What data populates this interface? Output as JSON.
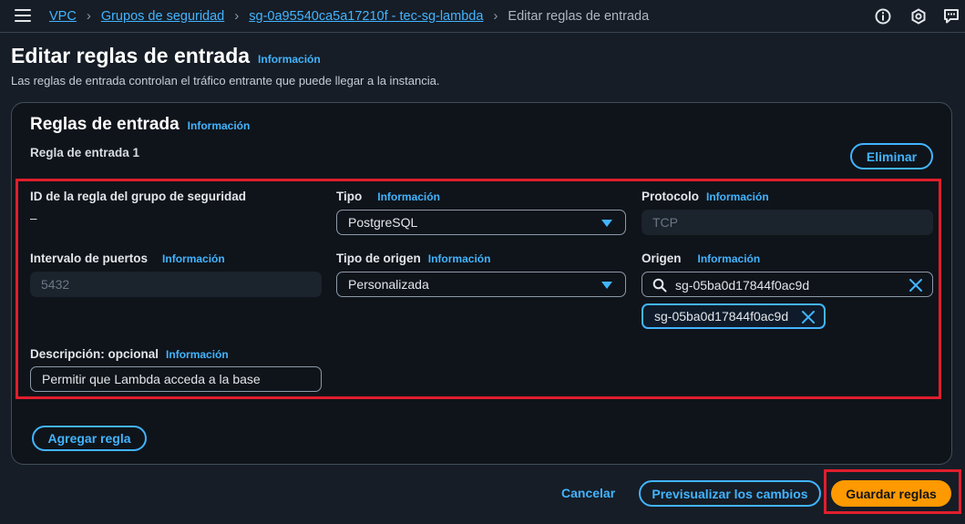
{
  "breadcrumb": {
    "items": [
      "VPC",
      "Grupos de seguridad",
      "sg-0a95540ca5a17210f - tec-sg-lambda"
    ],
    "current": "Editar reglas de entrada"
  },
  "page": {
    "title": "Editar reglas de entrada",
    "info": "Información",
    "description": "Las reglas de entrada controlan el tráfico entrante que puede llegar a la instancia."
  },
  "section": {
    "title": "Reglas de entrada",
    "info": "Información",
    "rule_label": "Regla de entrada 1",
    "delete_label": "Eliminar"
  },
  "rule": {
    "id_label": "ID de la regla del grupo de seguridad",
    "id_value": "–",
    "type_label": "Tipo",
    "type_info": "Información",
    "type_value": "PostgreSQL",
    "protocol_label": "Protocolo",
    "protocol_info": "Información",
    "protocol_value": "TCP",
    "port_label": "Intervalo de puertos",
    "port_info": "Información",
    "port_value": "5432",
    "source_type_label": "Tipo de origen",
    "source_type_info": "Información",
    "source_type_value": "Personalizada",
    "source_label": "Origen",
    "source_info": "Información",
    "source_search_value": "sg-05ba0d17844f0ac9d",
    "source_token": "sg-05ba0d17844f0ac9d",
    "description_label": "Descripción: opcional",
    "description_info": "Información",
    "description_value": "Permitir que Lambda acceda a la base"
  },
  "actions": {
    "add_rule": "Agregar regla",
    "cancel": "Cancelar",
    "preview": "Previsualizar los cambios",
    "save": "Guardar reglas"
  },
  "colors": {
    "link": "#42b4ff",
    "primary": "#ff9900",
    "highlight": "#e01e2d",
    "background": "#161d26"
  }
}
